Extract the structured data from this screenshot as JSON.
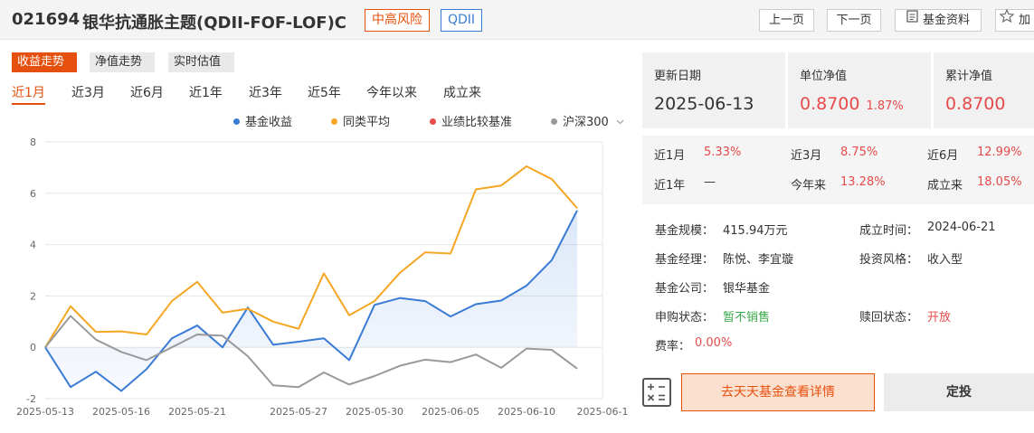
{
  "header": {
    "code": "021694",
    "name": "银华抗通胀主题(QDII-FOF-LOF)C",
    "risk_tag": "中高风险",
    "type_tag": "QDII",
    "prev_label": "上一页",
    "next_label": "下一页",
    "info_label": "基金资料",
    "fav_label": "加"
  },
  "chart_tabs": [
    "收益走势",
    "净值走势",
    "实时估值"
  ],
  "ranges": [
    "近1月",
    "近3月",
    "近6月",
    "近1年",
    "近3年",
    "近5年",
    "今年以来",
    "成立来"
  ],
  "legend": {
    "fund": "基金收益",
    "peer": "同类平均",
    "bench": "业绩比较基准",
    "index": "沪深300"
  },
  "colors": {
    "accent": "#e6500e",
    "fund": "#3a7bd5",
    "peer": "#f5a623",
    "bench": "#e64a4a",
    "index": "#999999",
    "up": "#e64a4a",
    "green": "#3aa84a"
  },
  "chart_data": {
    "type": "line",
    "x": [
      "2025-05-13",
      "2025-05-14",
      "2025-05-15",
      "2025-05-16",
      "2025-05-19",
      "2025-05-20",
      "2025-05-21",
      "2025-05-22",
      "2025-05-23",
      "2025-05-26",
      "2025-05-27",
      "2025-05-28",
      "2025-05-29",
      "2025-05-30",
      "2025-06-03",
      "2025-06-04",
      "2025-06-05",
      "2025-06-06",
      "2025-06-09",
      "2025-06-10",
      "2025-06-11",
      "2025-06-12",
      "2025-06-13"
    ],
    "x_tick_labels": [
      "2025-05-13",
      "2025-05-16",
      "2025-05-21",
      "2025-05-27",
      "2025-05-30",
      "2025-06-05",
      "2025-06-10",
      "2025-06-1"
    ],
    "x_tick_index": [
      0,
      3,
      6,
      10,
      13,
      16,
      19,
      22
    ],
    "ylim": [
      -2,
      8
    ],
    "yticks": [
      -2,
      0,
      2,
      4,
      6,
      8
    ],
    "grid": "horizontal",
    "series": [
      {
        "name": "基金收益",
        "values": [
          0,
          -1.55,
          -0.95,
          -1.7,
          -0.85,
          0.35,
          0.85,
          0.0,
          1.55,
          0.1,
          0.22,
          0.35,
          -0.5,
          1.65,
          1.92,
          1.8,
          1.2,
          1.68,
          1.82,
          2.4,
          3.4,
          5.33,
          null
        ]
      },
      {
        "name": "同类平均",
        "values": [
          0,
          1.6,
          0.6,
          0.62,
          0.5,
          1.8,
          2.55,
          1.35,
          1.5,
          1.0,
          0.72,
          2.88,
          1.25,
          1.8,
          2.9,
          3.7,
          3.65,
          6.15,
          6.3,
          7.05,
          6.55,
          5.42,
          null
        ]
      },
      {
        "name": "沪深300",
        "values": [
          0,
          1.22,
          0.3,
          -0.18,
          -0.5,
          0.0,
          0.5,
          0.45,
          -0.35,
          -1.48,
          -1.55,
          -0.98,
          -1.45,
          -1.12,
          -0.72,
          -0.48,
          -0.58,
          -0.28,
          -0.8,
          -0.05,
          -0.1,
          -0.83,
          null
        ]
      }
    ]
  },
  "summary": {
    "date_label": "更新日期",
    "date": "2025-06-13",
    "nav_label": "单位净值",
    "nav": "0.8700",
    "nav_change": "1.87%",
    "acc_label": "累计净值",
    "acc": "0.8700"
  },
  "performance": [
    {
      "label": "近1月",
      "value": "5.33%"
    },
    {
      "label": "近3月",
      "value": "8.75%"
    },
    {
      "label": "近6月",
      "value": "12.99%"
    },
    {
      "label": "近1年",
      "value": "—"
    },
    {
      "label": "今年来",
      "value": "13.28%"
    },
    {
      "label": "成立来",
      "value": "18.05%"
    }
  ],
  "info": {
    "scale_label": "基金规模：",
    "scale": "415.94万元",
    "setup_label": "成立时间：",
    "setup": "2024-06-21",
    "manager_label": "基金经理：",
    "manager": "陈悦、李宜璇",
    "style_label": "投资风格：",
    "style": "收入型",
    "company_label": "基金公司：",
    "company": "银华基金",
    "buy_label": "申购状态：",
    "buy": "暂不销售",
    "redeem_label": "赎回状态：",
    "redeem": "开放",
    "fee_label": "费率：",
    "fee": "0.00%"
  },
  "actions": {
    "detail": "去天天基金查看详情",
    "dingtou": "定投"
  }
}
